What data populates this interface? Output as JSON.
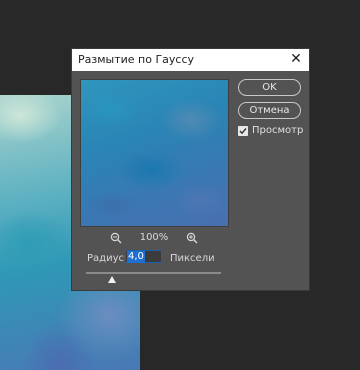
{
  "dialog": {
    "title": "Размытие по Гауссу",
    "close_icon": "close-icon",
    "buttons": {
      "ok_label": "OK",
      "cancel_label": "Отмена"
    },
    "preview_toggle": {
      "label": "Просмотр",
      "checked": true
    },
    "zoom": {
      "level": "100%",
      "zoom_out_icon": "zoom-out-icon",
      "zoom_in_icon": "zoom-in-icon"
    },
    "radius": {
      "label": "Радиус:",
      "value": "4,0",
      "unit": "Пиксели"
    }
  }
}
